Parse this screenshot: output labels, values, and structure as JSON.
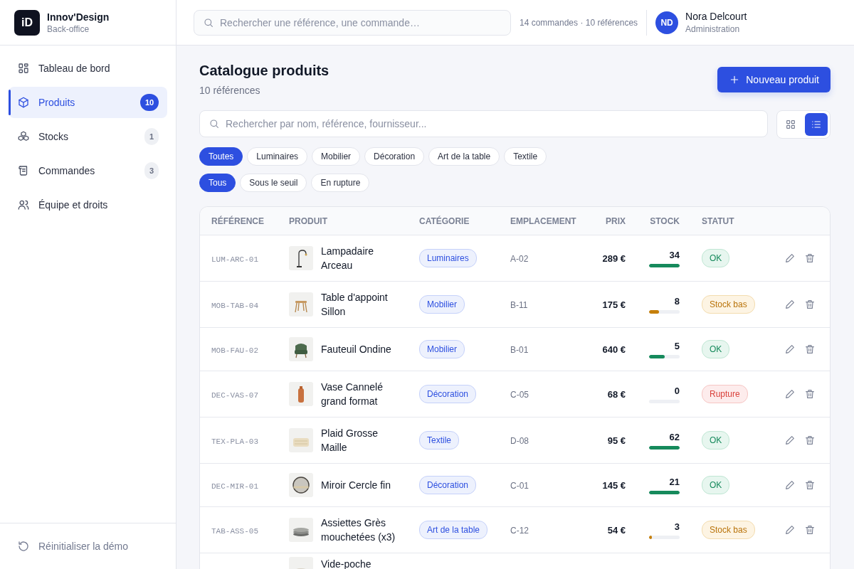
{
  "brand": {
    "logo": "iD",
    "name": "Innov'Design",
    "subtitle": "Back-office"
  },
  "nav": [
    {
      "label": "Tableau de bord",
      "selected": false
    },
    {
      "label": "Produits",
      "badge": "10",
      "selected": true
    },
    {
      "label": "Stocks",
      "badge": "1",
      "selected": false
    },
    {
      "label": "Commandes",
      "badge": "3",
      "selected": false
    },
    {
      "label": "Équipe et droits",
      "selected": false
    }
  ],
  "reset": "Réinitialiser la démo",
  "topbar": {
    "search_placeholder": "Rechercher une référence, une commande…",
    "summary": "14 commandes · 10 références",
    "user": {
      "initials": "ND",
      "name": "Nora Delcourt",
      "role": "Administration"
    }
  },
  "page": {
    "title": "Catalogue produits",
    "subtitle": "10 références",
    "new_button": "Nouveau produit",
    "search_placeholder": "Rechercher par nom, référence, fournisseur...",
    "views": [
      {
        "kind": "grid",
        "selected": false
      },
      {
        "kind": "list",
        "selected": true
      }
    ],
    "category_filters": [
      {
        "label": "Toutes",
        "selected": true
      },
      {
        "label": "Luminaires",
        "selected": false
      },
      {
        "label": "Mobilier",
        "selected": false
      },
      {
        "label": "Décoration",
        "selected": false
      },
      {
        "label": "Art de la table",
        "selected": false
      },
      {
        "label": "Textile",
        "selected": false
      }
    ],
    "status_filters": [
      {
        "label": "Tous",
        "selected": true
      },
      {
        "label": "Sous le seuil",
        "selected": false
      },
      {
        "label": "En rupture",
        "selected": false
      }
    ]
  },
  "table": {
    "columns": [
      "RÉFÉRENCE",
      "PRODUIT",
      "CATÉGORIE",
      "EMPLACEMENT",
      "PRIX",
      "STOCK",
      "STATUT"
    ],
    "rows": [
      {
        "reference": "LUM-ARC-01",
        "product": "Lampadaire Arceau",
        "category": "Luminaires",
        "location": "A-02",
        "price": "289 €",
        "stock": "34",
        "level": 1,
        "status": "OK",
        "kind": "ok"
      },
      {
        "reference": "MOB-TAB-04",
        "product": "Table d'appoint Sillon",
        "category": "Mobilier",
        "location": "B-11",
        "price": "175 €",
        "stock": "8",
        "level": 0.33,
        "status": "Stock bas",
        "kind": "low"
      },
      {
        "reference": "MOB-FAU-02",
        "product": "Fauteuil Ondine",
        "category": "Mobilier",
        "location": "B-01",
        "price": "640 €",
        "stock": "5",
        "level": 0.5,
        "status": "OK",
        "kind": "ok"
      },
      {
        "reference": "DEC-VAS-07",
        "product": "Vase Cannelé grand format",
        "category": "Décoration",
        "location": "C-05",
        "price": "68 €",
        "stock": "0",
        "level": 0,
        "status": "Rupture",
        "kind": "out"
      },
      {
        "reference": "TEX-PLA-03",
        "product": "Plaid Grosse Maille",
        "category": "Textile",
        "location": "D-08",
        "price": "95 €",
        "stock": "62",
        "level": 1,
        "status": "OK",
        "kind": "ok"
      },
      {
        "reference": "DEC-MIR-01",
        "product": "Miroir Cercle fin",
        "category": "Décoration",
        "location": "C-01",
        "price": "145 €",
        "stock": "21",
        "level": 1,
        "status": "OK",
        "kind": "ok"
      },
      {
        "reference": "TAB-ASS-05",
        "product": "Assiettes Grès mouchetées (x3)",
        "category": "Art de la table",
        "location": "C-12",
        "price": "54 €",
        "stock": "3",
        "level": 0.1,
        "status": "Stock bas",
        "kind": "low"
      },
      {
        "product": "Vide-poche",
        "kind": "partial"
      }
    ]
  }
}
